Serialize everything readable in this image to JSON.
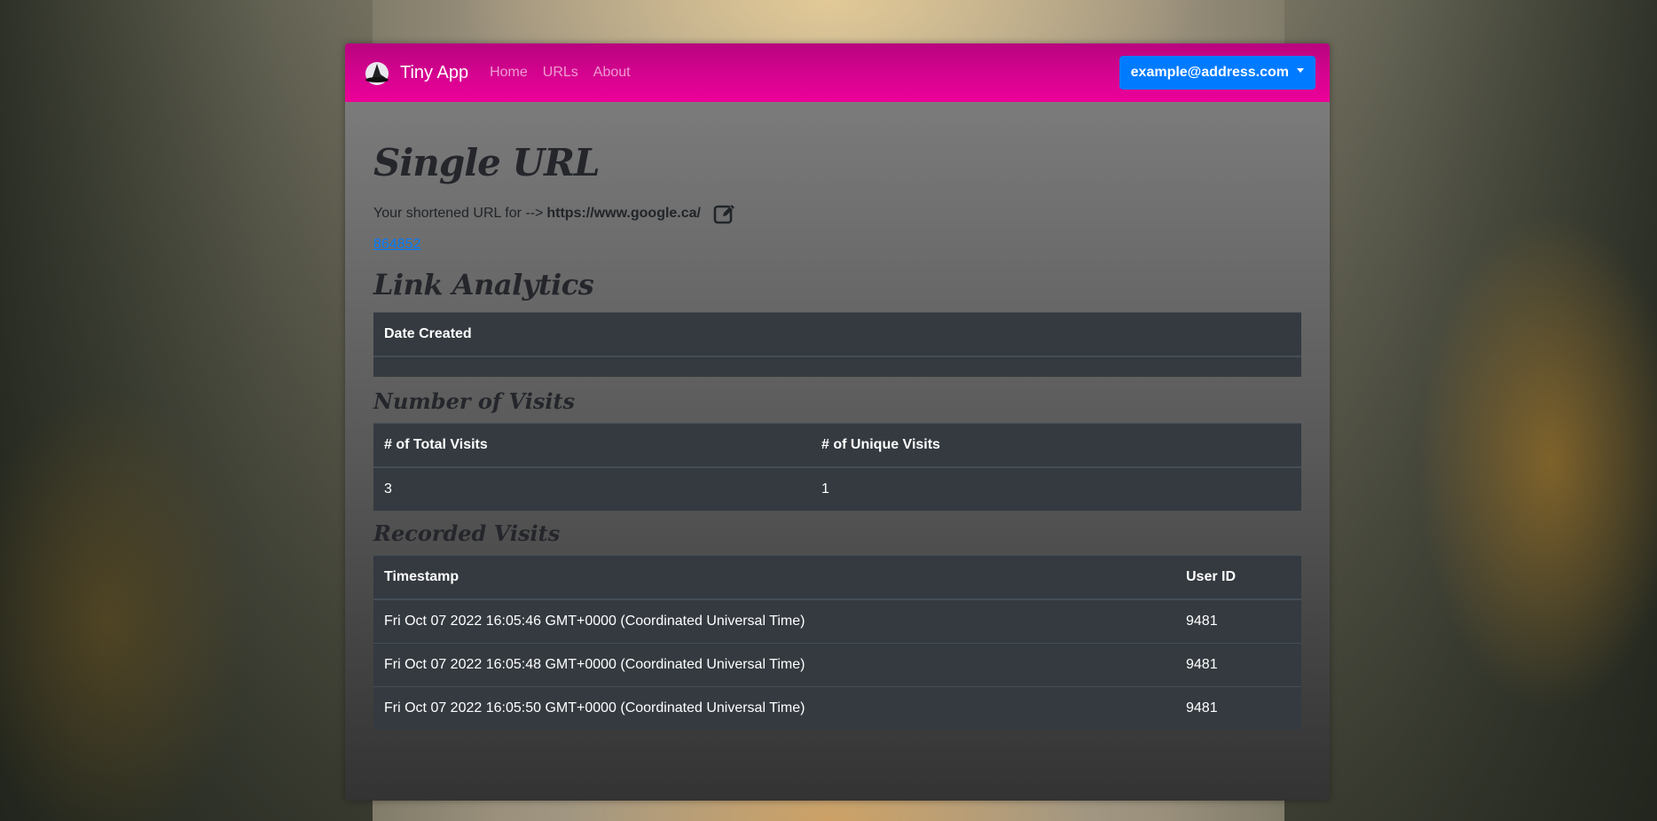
{
  "navbar": {
    "brand": "Tiny App",
    "links": [
      "Home",
      "URLs",
      "About"
    ],
    "user_email": "example@address.com"
  },
  "page": {
    "title": "Single URL",
    "shortened_prefix": "Your shortened URL for -->",
    "long_url": "https://www.google.ca/",
    "short_id": "864852"
  },
  "analytics": {
    "title": "Link Analytics",
    "date_table": {
      "header": "Date Created",
      "value": ""
    },
    "visits_title": "Number of Visits",
    "visits_table": {
      "headers": [
        "# of Total Visits",
        "# of Unique Visits"
      ],
      "values": [
        "3",
        "1"
      ]
    },
    "recorded_title": "Recorded Visits",
    "recorded_table": {
      "headers": [
        "Timestamp",
        "User ID"
      ],
      "rows": [
        [
          "Fri Oct 07 2022 16:05:46 GMT+0000 (Coordinated Universal Time)",
          "9481"
        ],
        [
          "Fri Oct 07 2022 16:05:48 GMT+0000 (Coordinated Universal Time)",
          "9481"
        ],
        [
          "Fri Oct 07 2022 16:05:50 GMT+0000 (Coordinated Universal Time)",
          "9481"
        ]
      ]
    }
  },
  "icons": {
    "logo": "witch-hat-icon",
    "edit": "edit-icon",
    "dropdown": "caret-down-icon"
  },
  "colors": {
    "navbar": "#d60390",
    "button": "#007bff",
    "table": "#343a40"
  }
}
